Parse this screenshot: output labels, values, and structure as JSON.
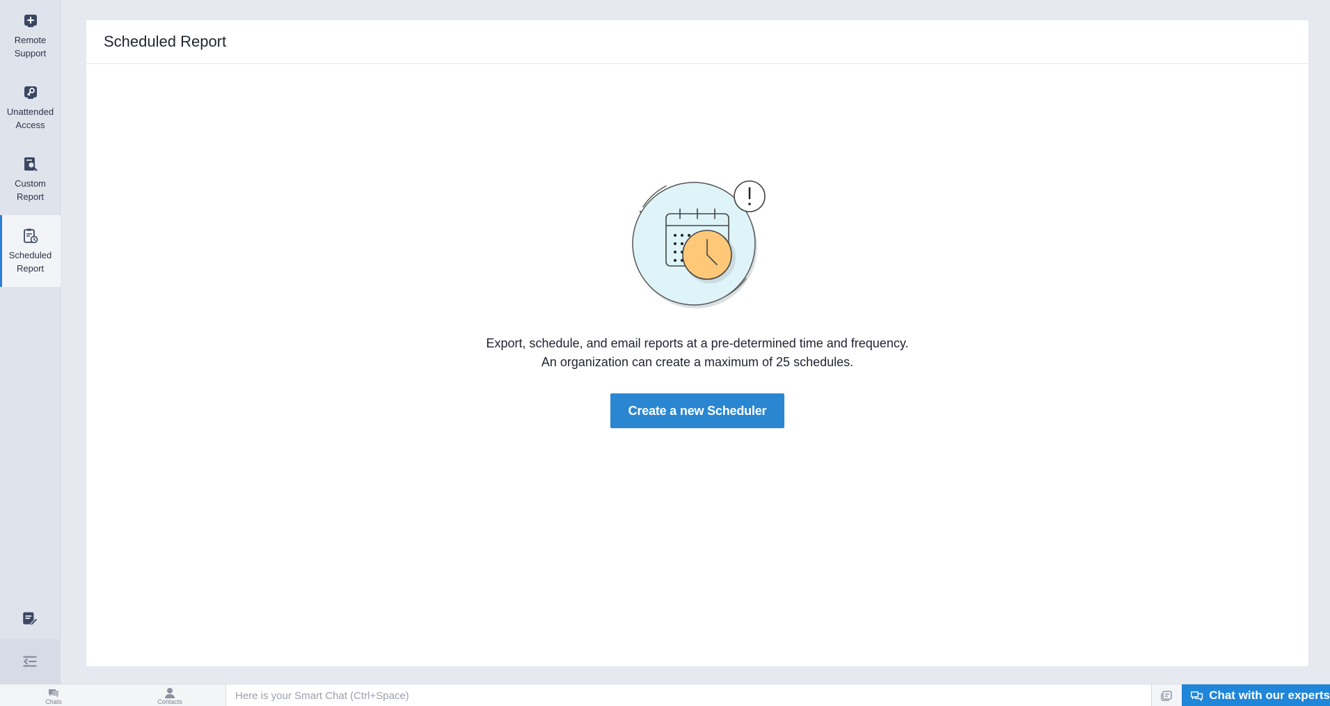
{
  "sidebar": {
    "items": [
      {
        "label": "Remote\nSupport",
        "icon": "remote-support-icon"
      },
      {
        "label": "Unattended\nAccess",
        "icon": "unattended-access-icon"
      },
      {
        "label": "Custom\nReport",
        "icon": "custom-report-icon"
      },
      {
        "label": "Scheduled\nReport",
        "icon": "scheduled-report-icon",
        "active": true
      }
    ],
    "bottom_icons": [
      "notes-edit-icon",
      "collapse-sidebar-icon"
    ]
  },
  "page": {
    "title": "Scheduled Report",
    "description_line1": "Export, schedule, and email reports at a pre-determined time and frequency.",
    "description_line2": "An organization can create a maximum of 25 schedules.",
    "cta_label": "Create a new Scheduler"
  },
  "bottombar": {
    "chats_label": "Chats",
    "contacts_label": "Contacts",
    "smart_chat_placeholder": "Here is your Smart Chat (Ctrl+Space)",
    "chat_experts_label": "Chat with our experts"
  },
  "colors": {
    "accent": "#2a86d1",
    "sidebar_bg": "#dfe3ec",
    "illustration_circle": "#def4f8",
    "illustration_clock": "#ffc878"
  }
}
